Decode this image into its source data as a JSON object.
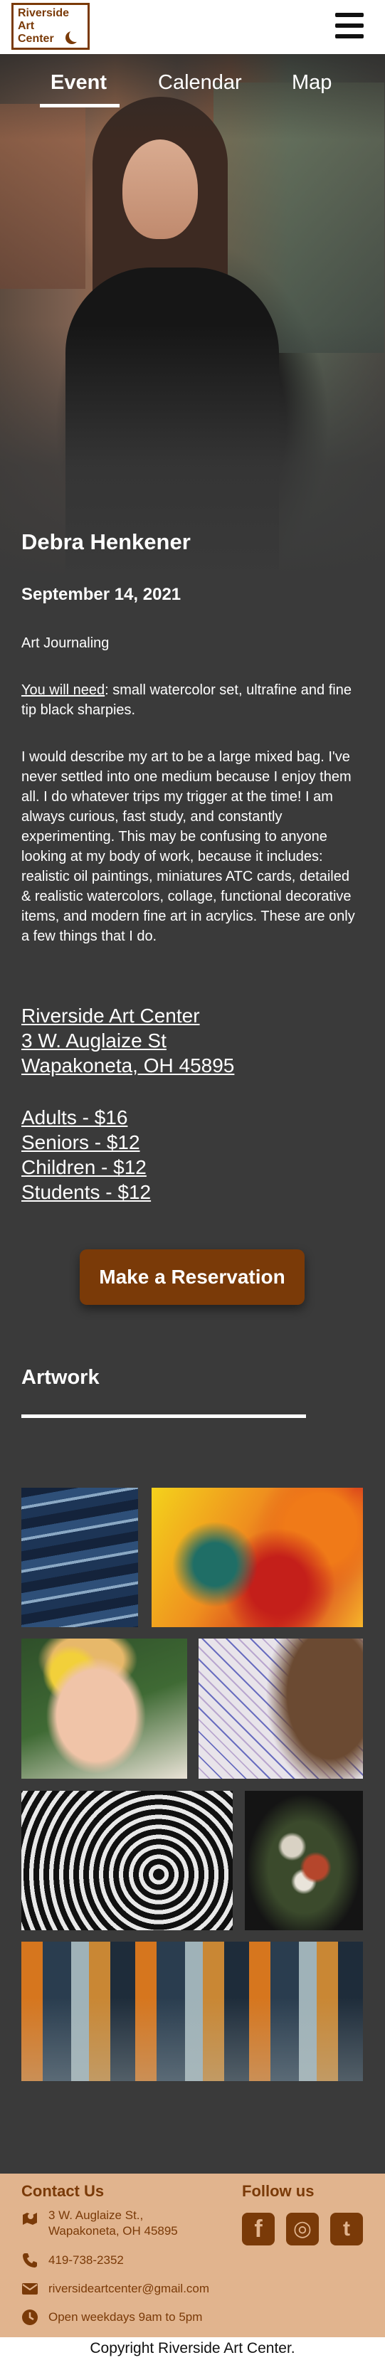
{
  "header": {
    "logo_line1": "Riverside",
    "logo_line2": "Art",
    "logo_line3": "Center",
    "menu_icon": "hamburger-icon"
  },
  "tabs": [
    {
      "label": "Event",
      "active": true
    },
    {
      "label": "Calendar",
      "active": false
    },
    {
      "label": "Map",
      "active": false
    }
  ],
  "event": {
    "artist": "Debra Henkener",
    "date": "September 14, 2021",
    "medium": "Art Journaling",
    "need_label": "You will need",
    "need_text": ": small watercolor set, ultrafine and fine tip black sharpies.",
    "description": "I would describe my art to be a large mixed bag. I've never settled into one medium because I enjoy them all. I do whatever trips my trigger at the time! I am always curious, fast study, and constantly experimenting. This may be confusing to anyone looking at my body of work, because it includes: realistic oil paintings, miniatures ATC cards, detailed & realistic watercolors, collage, functional decorative items, and modern fine art in acrylics. These are only a few things that I do.",
    "venue": [
      "Riverside Art Center",
      "3 W. Auglaize St",
      "Wapakoneta, OH 45895"
    ],
    "prices": [
      "Adults - $16",
      "Seniors - $12",
      "Children - $12",
      "Students - $12"
    ],
    "reserve_label": "Make a Reservation"
  },
  "artwork": {
    "title": "Artwork"
  },
  "footer": {
    "contact_title": "Contact Us",
    "address_line1": "3 W. Auglaize St.,",
    "address_line2": "Wapakoneta, OH 45895",
    "phone": "419-738-2352",
    "email": "riversideartcenter@gmail.com",
    "hours": "Open weekdays 9am to 5pm",
    "follow_title": "Follow us",
    "social": [
      {
        "name": "facebook-icon",
        "glyph": "f"
      },
      {
        "name": "instagram-icon",
        "glyph": "◎"
      },
      {
        "name": "twitter-icon",
        "glyph": "t"
      }
    ],
    "copyright": "Copyright Riverside Art Center."
  },
  "colors": {
    "brand": "#7a3a08",
    "page_bg": "#3a3a3a",
    "footer_bg": "#e1b48e"
  }
}
